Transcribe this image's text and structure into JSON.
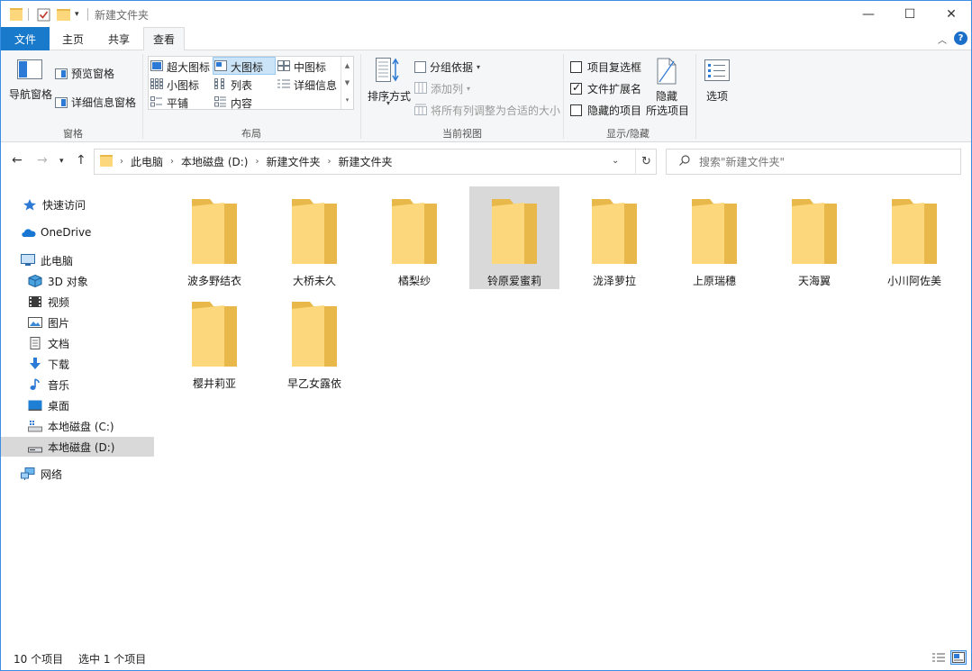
{
  "window": {
    "title": "新建文件夹",
    "controls": {
      "minimize": "—",
      "maximize": "☐",
      "close": "✕"
    }
  },
  "quick_access": {
    "dropdown": "▾"
  },
  "ribbon_tabs": [
    {
      "label": "文件",
      "active": false
    },
    {
      "label": "主页",
      "active": false
    },
    {
      "label": "共享",
      "active": false
    },
    {
      "label": "查看",
      "active": true
    }
  ],
  "ribbon": {
    "help": "?",
    "collapse": "︿",
    "panes": {
      "label": "窗格",
      "nav_pane": "导航窗格",
      "preview_pane": "预览窗格",
      "details_pane": "详细信息窗格"
    },
    "layout": {
      "label": "布局",
      "options": [
        "超大图标",
        "大图标",
        "中图标",
        "小图标",
        "列表",
        "详细信息",
        "平铺",
        "内容"
      ],
      "selected": "大图标"
    },
    "current_view": {
      "label": "当前视图",
      "sort_by": "排序方式",
      "group_by": "分组依据",
      "add_column": "添加列",
      "fit_columns": "将所有列调整为合适的大小"
    },
    "show_hide": {
      "label": "显示/隐藏",
      "item_checkboxes": {
        "label": "项目复选框",
        "checked": false
      },
      "file_extensions": {
        "label": "文件扩展名",
        "checked": true
      },
      "hidden_items": {
        "label": "隐藏的项目",
        "checked": false
      },
      "hide_selected_line1": "隐藏",
      "hide_selected_line2": "所选项目"
    },
    "options": "选项"
  },
  "address": {
    "crumbs": [
      "此电脑",
      "本地磁盘 (D:)",
      "新建文件夹",
      "新建文件夹"
    ],
    "search_placeholder": "搜索\"新建文件夹\""
  },
  "nav_pane": [
    {
      "label": "快速访问",
      "icon": "star-icon"
    },
    {
      "label": "OneDrive",
      "icon": "cloud-icon"
    },
    {
      "label": "此电脑",
      "icon": "computer-icon"
    },
    {
      "label": "3D 对象",
      "icon": "cube-icon"
    },
    {
      "label": "视频",
      "icon": "video-icon"
    },
    {
      "label": "图片",
      "icon": "picture-icon"
    },
    {
      "label": "文档",
      "icon": "document-icon"
    },
    {
      "label": "下载",
      "icon": "download-icon"
    },
    {
      "label": "音乐",
      "icon": "music-icon"
    },
    {
      "label": "桌面",
      "icon": "desktop-icon"
    },
    {
      "label": "本地磁盘 (C:)",
      "icon": "drive-c-icon"
    },
    {
      "label": "本地磁盘 (D:)",
      "icon": "drive-d-icon",
      "selected": true
    },
    {
      "label": "网络",
      "icon": "network-icon"
    }
  ],
  "folders": [
    {
      "name": "波多野结衣"
    },
    {
      "name": "大桥未久"
    },
    {
      "name": "橘梨纱"
    },
    {
      "name": "铃原爱蜜莉",
      "selected": true
    },
    {
      "name": "泷泽萝拉"
    },
    {
      "name": "上原瑞穗"
    },
    {
      "name": "天海翼"
    },
    {
      "name": "小川阿佐美"
    },
    {
      "name": "樱井莉亚"
    },
    {
      "name": "早乙女露依"
    }
  ],
  "status": {
    "item_count": "10 个项目",
    "selection": "选中 1 个项目"
  },
  "colors": {
    "accent": "#1979ca",
    "folder_back": "#e8b94a",
    "folder_front": "#fcd77c",
    "selection": "#d9d9d9"
  }
}
